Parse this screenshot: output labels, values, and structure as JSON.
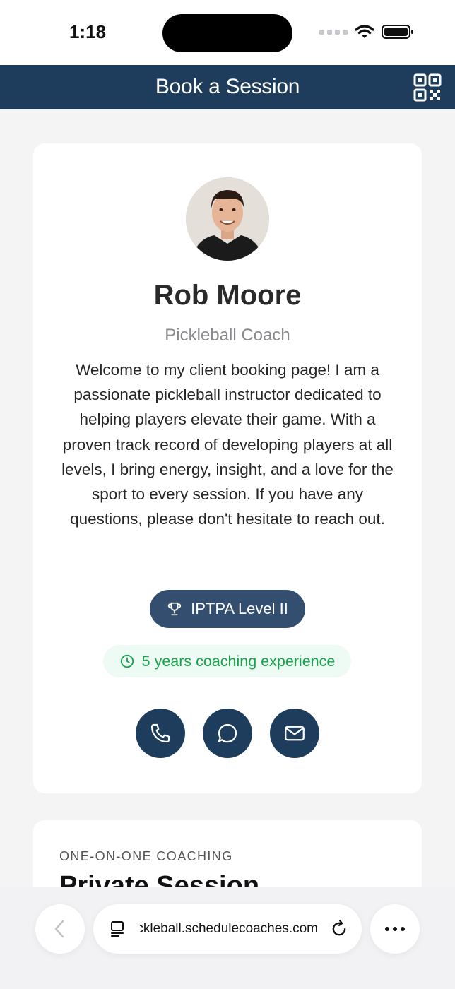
{
  "status_bar": {
    "time": "1:18"
  },
  "header": {
    "title": "Book a Session",
    "qr_icon": "qr-code-icon"
  },
  "profile": {
    "name": "Rob Moore",
    "title": "Pickleball Coach",
    "bio": "Welcome to my client booking page! I am a passionate pickleball instructor dedicated to helping players elevate their game. With a proven track record of developing players at all levels, I bring energy, insight, and a love for the sport to every session. If you have any questions, please don't hesitate to reach out.",
    "certification": "IPTPA Level II",
    "experience": "5 years coaching experience",
    "contact_icons": [
      "phone-icon",
      "chat-icon",
      "mail-icon"
    ]
  },
  "session": {
    "category": "ONE-ON-ONE COACHING",
    "title": "Private Session"
  },
  "browser": {
    "url": "pickleball.schedulecoaches.com"
  },
  "colors": {
    "primary": "#1e3d5c",
    "badge": "#334e6f",
    "success": "#16a34a",
    "success_bg": "#eefaf4"
  }
}
